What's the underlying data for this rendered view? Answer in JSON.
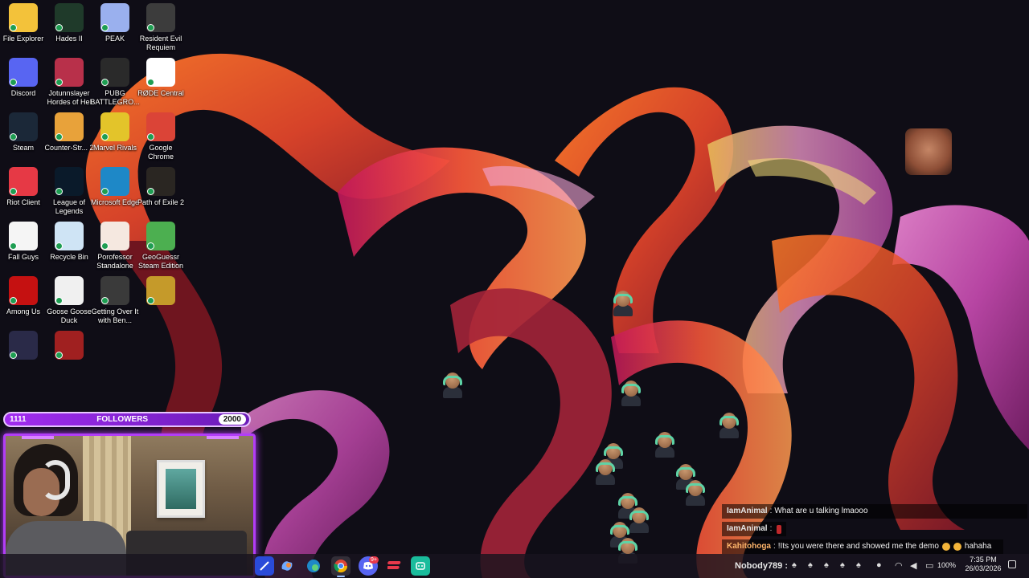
{
  "desktop": {
    "icons": [
      {
        "label": "File Explorer",
        "icon": "folder-icon",
        "color": "#f3c23a"
      },
      {
        "label": "Hades II",
        "icon": "hades-icon",
        "color": "#1f3a2a"
      },
      {
        "label": "PEAK",
        "icon": "peak-icon",
        "color": "#9ab0ee"
      },
      {
        "label": "Resident Evil Requiem",
        "icon": "resident-evil-icon",
        "color": "#3c3c3c"
      },
      {
        "label": "Discord",
        "icon": "discord-icon",
        "color": "#5865f2"
      },
      {
        "label": "Jotunnslayer Hordes of Hel",
        "icon": "jotunnslayer-icon",
        "color": "#b8304a"
      },
      {
        "label": "PUBG BATTLEGRO...",
        "icon": "pubg-icon",
        "color": "#2a2a2a"
      },
      {
        "label": "RØDE Central",
        "icon": "rode-icon",
        "color": "#ffffff"
      },
      {
        "label": "Steam",
        "icon": "steam-icon",
        "color": "#1b2838"
      },
      {
        "label": "Counter-Str... 2",
        "icon": "counter-strike-icon",
        "color": "#e8a23a"
      },
      {
        "label": "Marvel Rivals",
        "icon": "marvel-rivals-icon",
        "color": "#e3c42a"
      },
      {
        "label": "Google Chrome",
        "icon": "chrome-icon",
        "color": "#db4437"
      },
      {
        "label": "Riot Client",
        "icon": "riot-client-icon",
        "color": "#e63945"
      },
      {
        "label": "League of Legends",
        "icon": "league-of-legends-icon",
        "color": "#0a1a2a"
      },
      {
        "label": "Microsoft Edge",
        "icon": "edge-icon",
        "color": "#1e88c7"
      },
      {
        "label": "Path of Exile 2",
        "icon": "path-of-exile-icon",
        "color": "#2a2622"
      },
      {
        "label": "Fall Guys",
        "icon": "file-icon",
        "color": "#f5f5f5"
      },
      {
        "label": "Recycle Bin",
        "icon": "recycle-bin-icon",
        "color": "#cfe4f5"
      },
      {
        "label": "Porofessor Standalone",
        "icon": "porofessor-icon",
        "color": "#f5e8e0"
      },
      {
        "label": "GeoGuessr Steam Edition",
        "icon": "geoguessr-icon",
        "color": "#4caf50"
      },
      {
        "label": "Among Us",
        "icon": "among-us-icon",
        "color": "#c51111"
      },
      {
        "label": "Goose Goose Duck",
        "icon": "goose-icon",
        "color": "#f0f0f0"
      },
      {
        "label": "Getting Over It with Ben...",
        "icon": "hammer-icon",
        "color": "#3a3a3a"
      },
      {
        "label": "",
        "icon": "survivor-icon",
        "color": "#c59a2a"
      },
      {
        "label": "",
        "icon": "feather-icon",
        "color": "#2a2a48"
      },
      {
        "label": "",
        "icon": "hooded-icon",
        "color": "#a02020"
      }
    ]
  },
  "overlay": {
    "follower_goal": {
      "current": "1111",
      "label": "FOLLOWERS",
      "target": "2000"
    },
    "chat": [
      {
        "user": "IamAnimal",
        "sep": ":",
        "text": "What are u talking lmaooo",
        "style": "white"
      },
      {
        "user": "IamAnimal",
        "sep": ":",
        "text": "",
        "style": "white"
      },
      {
        "user": "Kahitohoga",
        "sep": ":",
        "text": "!Its you were there and showed me the demo",
        "extra": "hahaha",
        "style": "orange"
      }
    ]
  },
  "taskbar": {
    "apps": [
      "codex-icon",
      "copilot-icon",
      "edge-icon",
      "chrome-icon",
      "discord-icon",
      "asana-icon",
      "app-icon"
    ],
    "discord_badge": "9+",
    "tray_user": "Nobody789 :",
    "battery": "100%",
    "time": "7:35 PM",
    "date": "26/03/2026"
  },
  "colors": {
    "accent": "#b23df7",
    "follower_bar": "#a22cf0"
  }
}
